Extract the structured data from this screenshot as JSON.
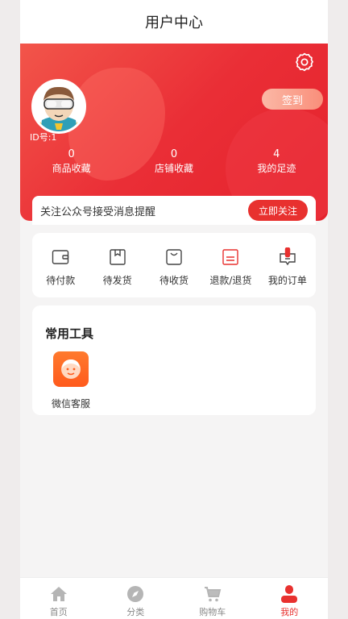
{
  "header": {
    "title": "用户中心"
  },
  "profile": {
    "id_text": "ID号:1",
    "sign_label": "签到",
    "stats": [
      {
        "num": "0",
        "label": "商品收藏"
      },
      {
        "num": "0",
        "label": "店铺收藏"
      },
      {
        "num": "4",
        "label": "我的足迹"
      }
    ]
  },
  "follow": {
    "text": "关注公众号接受消息提醒",
    "button": "立即关注"
  },
  "orders": [
    {
      "label": "待付款",
      "icon": "wallet-icon"
    },
    {
      "label": "待发货",
      "icon": "package-icon"
    },
    {
      "label": "待收货",
      "icon": "box-open-icon"
    },
    {
      "label": "退款/退货",
      "icon": "refund-icon"
    },
    {
      "label": "我的订单",
      "icon": "order-list-icon"
    }
  ],
  "tools": {
    "title": "常用工具",
    "items": [
      {
        "label": "微信客服",
        "icon": "customer-service-icon"
      }
    ]
  },
  "tabs": [
    {
      "label": "首页",
      "icon": "home-icon"
    },
    {
      "label": "分类",
      "icon": "compass-icon"
    },
    {
      "label": "购物车",
      "icon": "cart-icon"
    },
    {
      "label": "我的",
      "icon": "user-icon",
      "active": true
    }
  ],
  "colors": {
    "accent": "#e8312f",
    "tool_orange": "#ff6a22"
  }
}
